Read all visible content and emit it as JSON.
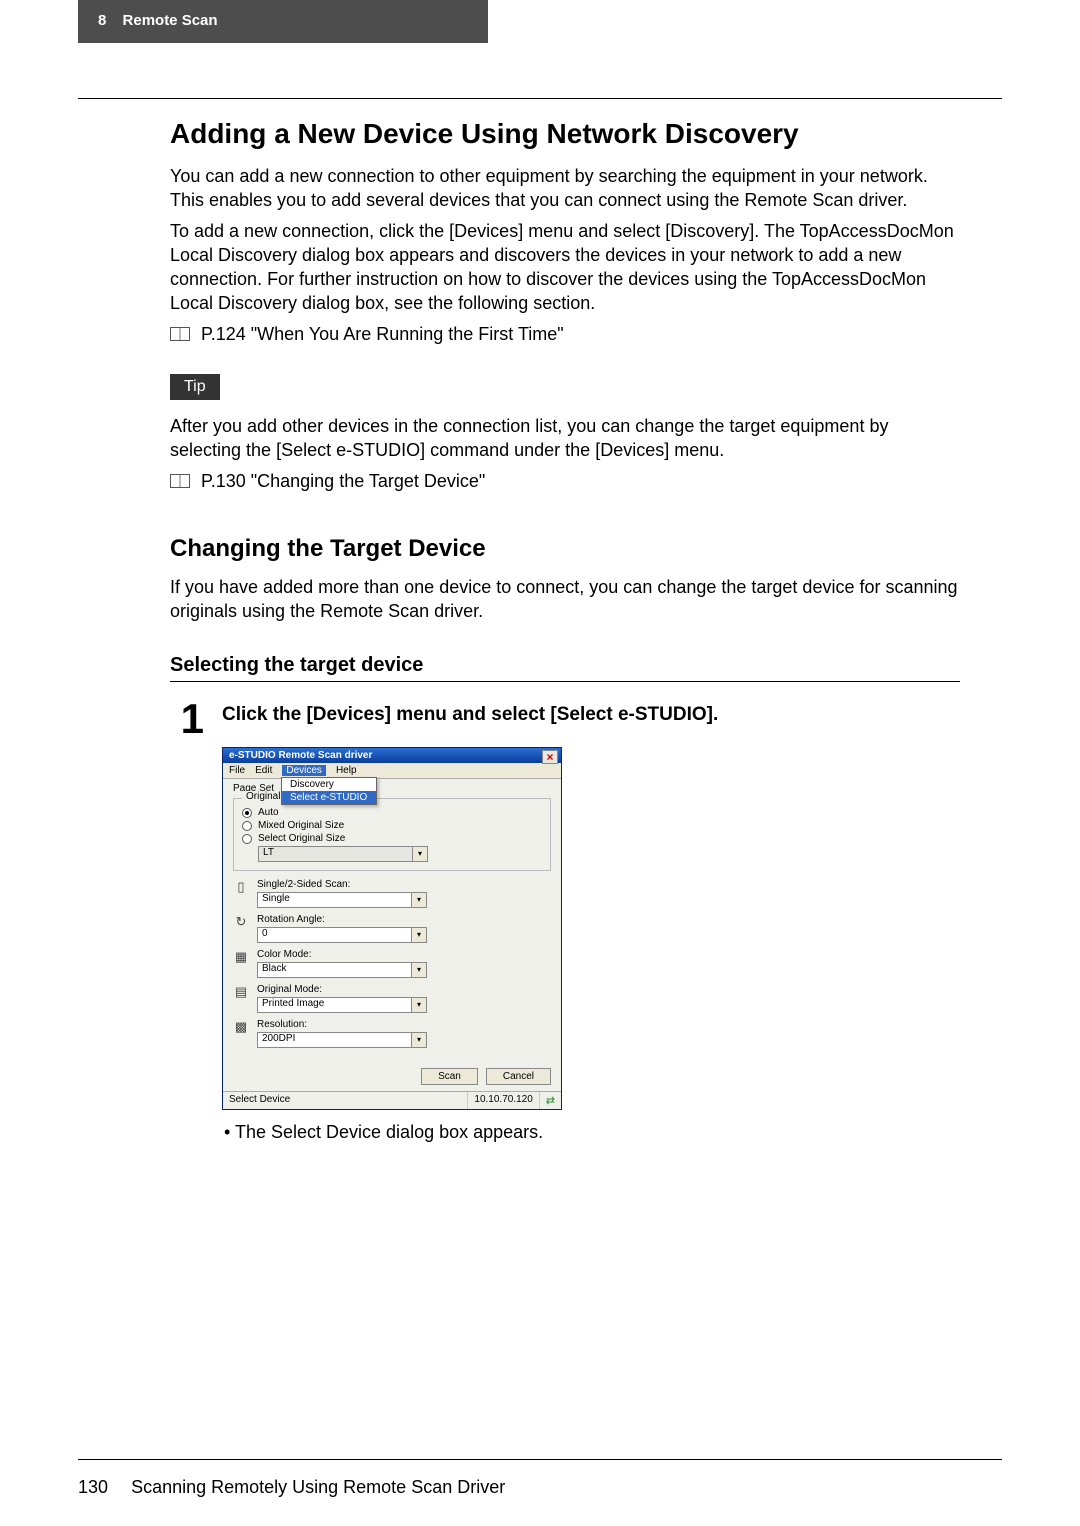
{
  "header": {
    "chapter": "8",
    "title": "Remote Scan"
  },
  "h1": "Adding a New Device Using Network Discovery",
  "para1": "You can add a new connection to other equipment by searching the equipment in your network. This enables you to add several devices that you can connect using the Remote Scan driver.",
  "para2": "To add a new connection, click the [Devices] menu and select [Discovery].  The TopAccessDocMon Local Discovery dialog box appears and discovers the devices in your network to add a new connection.  For further instruction on how to discover the devices using the TopAccessDocMon Local Discovery dialog box, see the following section.",
  "ref1": "P.124 \"When You Are Running the First Time\"",
  "tip_label": "Tip",
  "tip_text": "After you add other devices in the connection list, you can change the target equipment by selecting the [Select e-STUDIO] command under the [Devices] menu.",
  "ref2": "P.130 \"Changing the Target Device\"",
  "h2": "Changing the Target Device",
  "para3": "If you have added more than one device to connect, you can change the target device for scanning originals using the Remote Scan driver.",
  "h3": "Selecting the target device",
  "step_num": "1",
  "step_title": "Click the [Devices] menu and select [Select e-STUDIO].",
  "dialog": {
    "title": "e-STUDIO Remote Scan driver",
    "menu": [
      "File",
      "Edit",
      "Devices",
      "Help"
    ],
    "submenu": {
      "item1": "Discovery",
      "item2": "Select e-STUDIO"
    },
    "page_set": "Page Set",
    "group_original_size": "Original Size",
    "opt_auto": "Auto",
    "opt_mixed": "Mixed Original Size",
    "opt_select": "Select Original Size",
    "size_combo": "LT",
    "label_sided": "Single/2-Sided Scan:",
    "val_sided": "Single",
    "label_rotation": "Rotation Angle:",
    "val_rotation": "0",
    "label_color": "Color Mode:",
    "val_color": "Black",
    "label_origmode": "Original Mode:",
    "val_origmode": "Printed Image",
    "label_res": "Resolution:",
    "val_res": "200DPI",
    "btn_scan": "Scan",
    "btn_cancel": "Cancel",
    "status_left": "Select Device",
    "status_ip": "10.10.70.120"
  },
  "after_dialog": "• The Select Device dialog box appears.",
  "footer": {
    "page": "130",
    "title": "Scanning Remotely Using Remote Scan Driver"
  }
}
